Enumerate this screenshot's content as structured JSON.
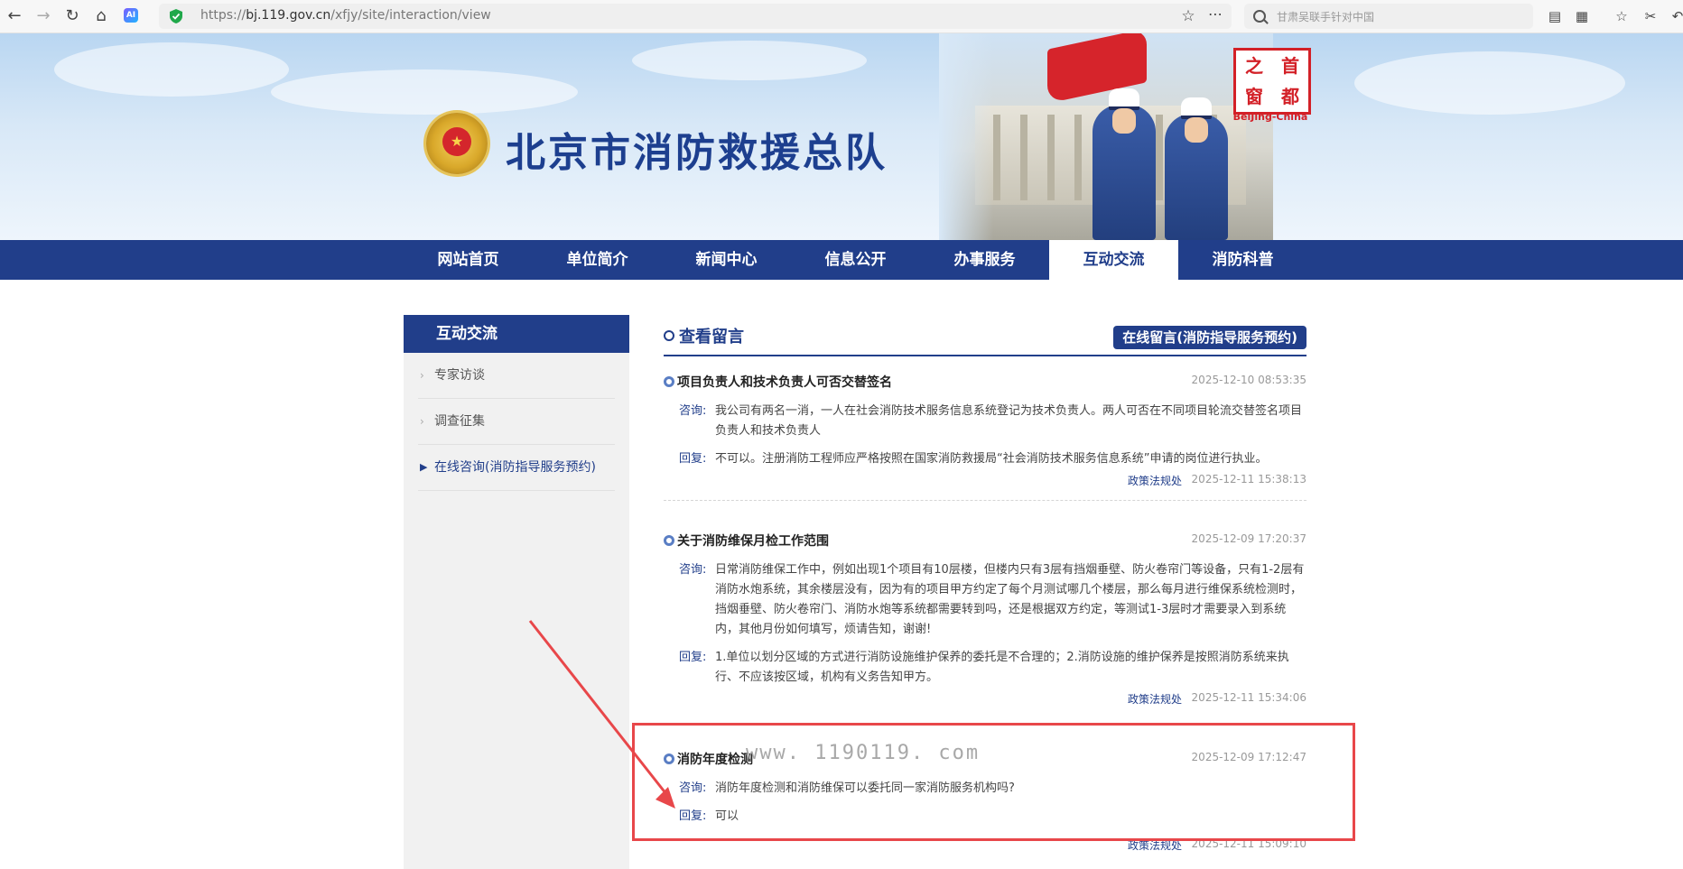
{
  "browser": {
    "url_gray_prefix": "https://",
    "url_domain": "bj.119.gov.cn",
    "url_path": "/xfjy/site/interaction/view",
    "search_placeholder": "甘肃吴联手针对中国",
    "ai_label": "AI"
  },
  "header": {
    "site_title": "北京市消防救援总队",
    "badge_chars": [
      "之",
      "首",
      "窗",
      "都"
    ],
    "badge_label": "BeiJing-China"
  },
  "nav": {
    "items": [
      {
        "label": "网站首页"
      },
      {
        "label": "单位简介"
      },
      {
        "label": "新闻中心"
      },
      {
        "label": "信息公开"
      },
      {
        "label": "办事服务"
      },
      {
        "label": "互动交流"
      },
      {
        "label": "消防科普"
      }
    ],
    "active_index": 5
  },
  "sidebar": {
    "title": "互动交流",
    "items": [
      {
        "label": "专家访谈"
      },
      {
        "label": "调查征集"
      },
      {
        "label": "在线咨询(消防指导服务预约)"
      }
    ]
  },
  "main": {
    "section_title": "查看留言",
    "online_button": "在线留言(消防指导服务预约)",
    "ask_label": "咨询:",
    "reply_label": "回复:",
    "messages": [
      {
        "title": "项目负责人和技术负责人可否交替签名",
        "date": "2025-12-10 08:53:35",
        "question": "我公司有两名一消，一人在社会消防技术服务信息系统登记为技术负责人。两人可否在不同项目轮流交替签名项目负责人和技术负责人",
        "answer": "不可以。注册消防工程师应严格按照在国家消防救援局“社会消防技术服务信息系统”申请的岗位进行执业。",
        "category": "政策法规处",
        "reply_date": "2025-12-11 15:38:13"
      },
      {
        "title": "关于消防维保月检工作范围",
        "date": "2025-12-09 17:20:37",
        "question": "日常消防维保工作中，例如出现1个项目有10层楼，但楼内只有3层有挡烟垂壁、防火卷帘门等设备，只有1-2层有消防水炮系统，其余楼层没有，因为有的项目甲方约定了每个月测试哪几个楼层，那么每月进行维保系统检测时，挡烟垂壁、防火卷帘门、消防水炮等系统都需要转到吗，还是根据双方约定，等测试1-3层时才需要录入到系统内，其他月份如何填写，烦请告知，谢谢!",
        "answer": "1.单位以划分区域的方式进行消防设施维护保养的委托是不合理的；2.消防设施的维护保养是按照消防系统来执行、不应该按区域，机构有义务告知甲方。",
        "category": "政策法规处",
        "reply_date": "2025-12-11 15:34:06"
      },
      {
        "title": "消防年度检测",
        "date": "2025-12-09 17:12:47",
        "question": "消防年度检测和消防维保可以委托同一家消防服务机构吗?",
        "answer": "可以",
        "category": "政策法规处",
        "reply_date": "2025-12-11 15:09:10"
      }
    ]
  },
  "watermark": "www. 1190119. com",
  "colors": {
    "nav_blue": "#213e8a",
    "highlight_red": "#e8474a",
    "emblem_red": "#d32027"
  }
}
